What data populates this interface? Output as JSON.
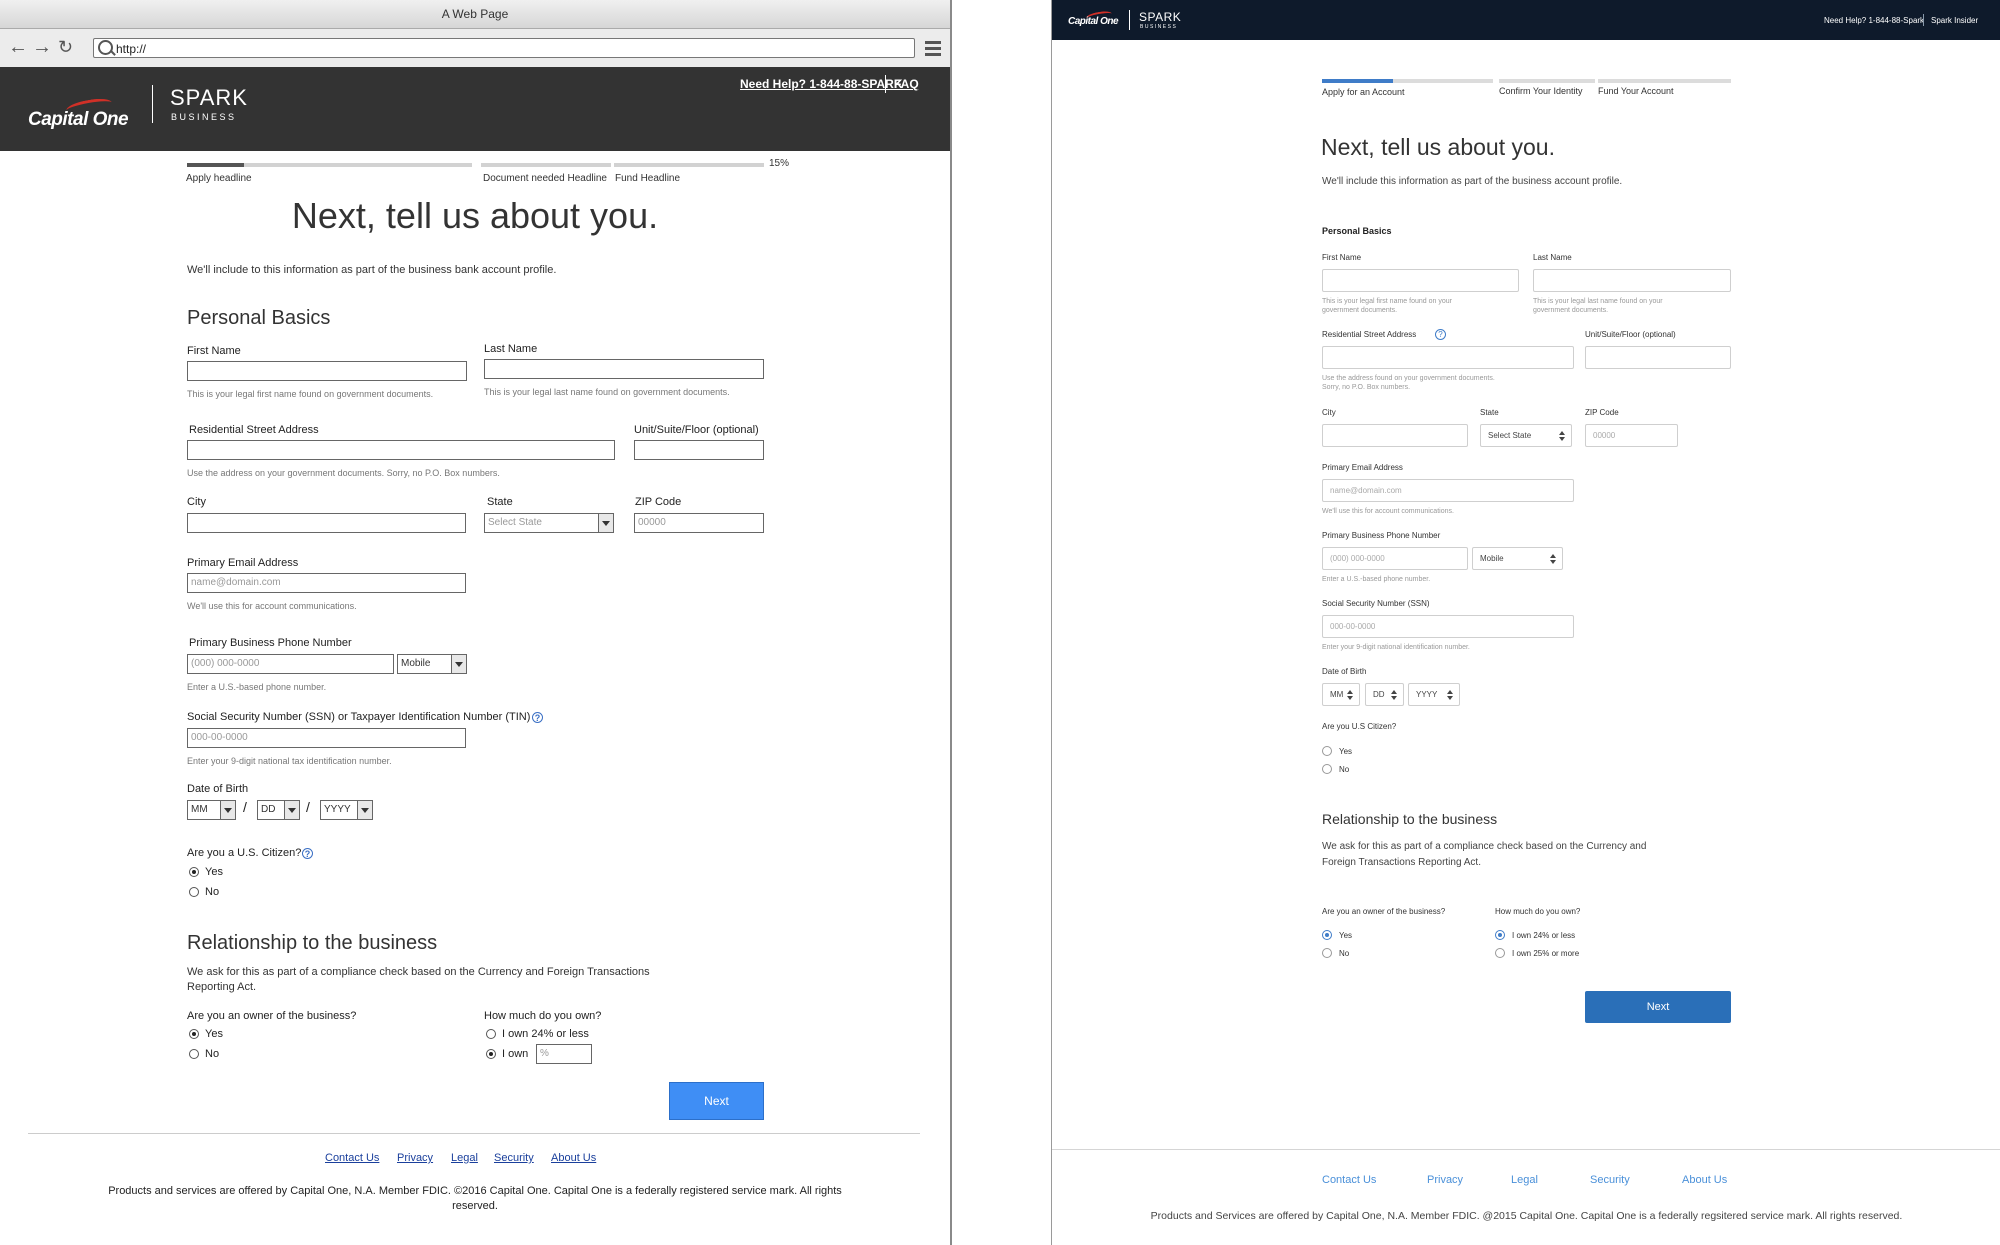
{
  "colors": {
    "wire_header": "#333333",
    "wire_next": "#3f8ef5",
    "hifi_header": "#0e1a2b",
    "hifi_accent": "#3f7cc8",
    "hifi_next": "#2a6fb8",
    "brand_red": "#d03027"
  },
  "wire": {
    "window_title": "A Web Page",
    "url": "http://",
    "icons": {
      "back": "back-arrow-icon",
      "forward": "forward-arrow-icon",
      "refresh": "refresh-icon",
      "search": "search-icon",
      "menu": "hamburger-menu-icon"
    },
    "header": {
      "help_link": "Need Help? 1-844-88-SPARK",
      "faq_link": "FAQ",
      "logo_brand": "Capital One",
      "logo_product": "SPARK",
      "logo_sub": "BUSINESS"
    },
    "progress": {
      "steps": [
        "Apply headline",
        "Document needed Headline",
        "Fund Headline"
      ],
      "percent_label": "15%",
      "percent": 15
    },
    "heading": "Next, tell us about you.",
    "intro": "We'll include to this information as part of the business bank account profile.",
    "personal_title": "Personal Basics",
    "first_name": {
      "label": "First Name",
      "hint": "This is your legal first name found on government documents."
    },
    "last_name": {
      "label": "Last Name",
      "hint": "This is your legal last name found on government documents."
    },
    "street": {
      "label": "Residential Street Address",
      "hint": "Use the address on your government documents. Sorry, no P.O. Box numbers."
    },
    "unit": {
      "label": "Unit/Suite/Floor (optional)"
    },
    "city": {
      "label": "City"
    },
    "state": {
      "label": "State",
      "value": "Select State"
    },
    "zip": {
      "label": "ZIP Code",
      "placeholder": "00000"
    },
    "email": {
      "label": "Primary Email Address",
      "placeholder": "name@domain.com",
      "hint": "We'll use this for account communications."
    },
    "phone": {
      "label": "Primary Business Phone Number",
      "placeholder": "(000) 000-0000",
      "type": "Mobile",
      "hint": "Enter a U.S.-based phone number."
    },
    "ssn": {
      "label": "Social Security Number (SSN) or Taxpayer Identification Number (TIN)",
      "placeholder": "000-00-0000",
      "hint": "Enter your 9-digit national tax identification number."
    },
    "dob": {
      "label": "Date of Birth",
      "mm": "MM",
      "dd": "DD",
      "yyyy": "YYYY",
      "sep": "/"
    },
    "citizen": {
      "label": "Are you a U.S. Citizen?",
      "yes": "Yes",
      "no": "No"
    },
    "relationship": {
      "title": "Relationship to the business",
      "body": "We ask for this as part of a compliance check based on the Currency and Foreign Transactions Reporting Act.",
      "owner_q": "Are you an owner of the business?",
      "yes": "Yes",
      "no": "No",
      "own_q": "How much do you own?",
      "own_24": "I own 24% or less",
      "own_custom": "I own",
      "own_placeholder": "%"
    },
    "next": "Next",
    "footer": {
      "links": [
        "Contact Us",
        "Privacy",
        "Legal",
        "Security",
        "About Us"
      ],
      "legal": "Products and services are offered by Capital One, N.A. Member FDIC. ©2016 Capital One. Capital One is a federally registered service mark. All rights reserved."
    }
  },
  "hifi": {
    "header": {
      "help": "Need Help? 1-844-88-Spark",
      "insider": "Spark Insider",
      "logo_brand": "Capital One",
      "logo_product": "SPARK",
      "logo_sub": "BUSINESS"
    },
    "steps": [
      "Apply for an Account",
      "Confirm Your Identity",
      "Fund Your Account"
    ],
    "heading": "Next, tell us about you.",
    "intro": "We'll include this information as part of the business account profile.",
    "personal_title": "Personal Basics",
    "first_name": {
      "label": "First Name",
      "hint1": "This is your legal first name found on your",
      "hint2": "government documents."
    },
    "last_name": {
      "label": "Last Name",
      "hint1": "This is your legal last name found on your",
      "hint2": "government documents."
    },
    "street": {
      "label": "Residential Street Address",
      "hint1": "Use the address found on your government documents.",
      "hint2": "Sorry, no P.O. Box numbers."
    },
    "unit": {
      "label": "Unit/Suite/Floor (optional)"
    },
    "city": {
      "label": "City"
    },
    "state": {
      "label": "State",
      "value": "Select State"
    },
    "zip": {
      "label": "ZIP Code",
      "placeholder": "00000"
    },
    "email": {
      "label": "Primary Email Address",
      "placeholder": "name@domain.com",
      "hint": "We'll use this for account communications."
    },
    "phone": {
      "label": "Primary Business Phone Number",
      "placeholder": "(000) 000-0000",
      "type": "Mobile",
      "hint": "Enter a U.S.-based phone number."
    },
    "ssn": {
      "label": "Social Security Number (SSN)",
      "placeholder": "000-00-0000",
      "hint": "Enter your 9-digit national identification number."
    },
    "dob": {
      "label": "Date of Birth",
      "mm": "MM",
      "dd": "DD",
      "yyyy": "YYYY"
    },
    "citizen": {
      "label": "Are you U.S Citizen?",
      "yes": "Yes",
      "no": "No"
    },
    "relationship": {
      "title": "Relationship to the business",
      "body1": "We ask for this as part of a compliance check based on the Currency and",
      "body2": "Foreign Transactions Reporting Act.",
      "owner_q": "Are you an owner of the business?",
      "yes": "Yes",
      "no": "No",
      "own_q": "How much do you own?",
      "own_24": "I own 24% or less",
      "own_25": "I own 25% or more"
    },
    "next": "Next",
    "footer": {
      "links": [
        "Contact Us",
        "Privacy",
        "Legal",
        "Security",
        "About Us"
      ],
      "legal": "Products and Services are offered by Capital One, N.A. Member FDIC. @2015 Capital One. Capital One is a federally regsitered service mark. All rights reserved."
    }
  }
}
